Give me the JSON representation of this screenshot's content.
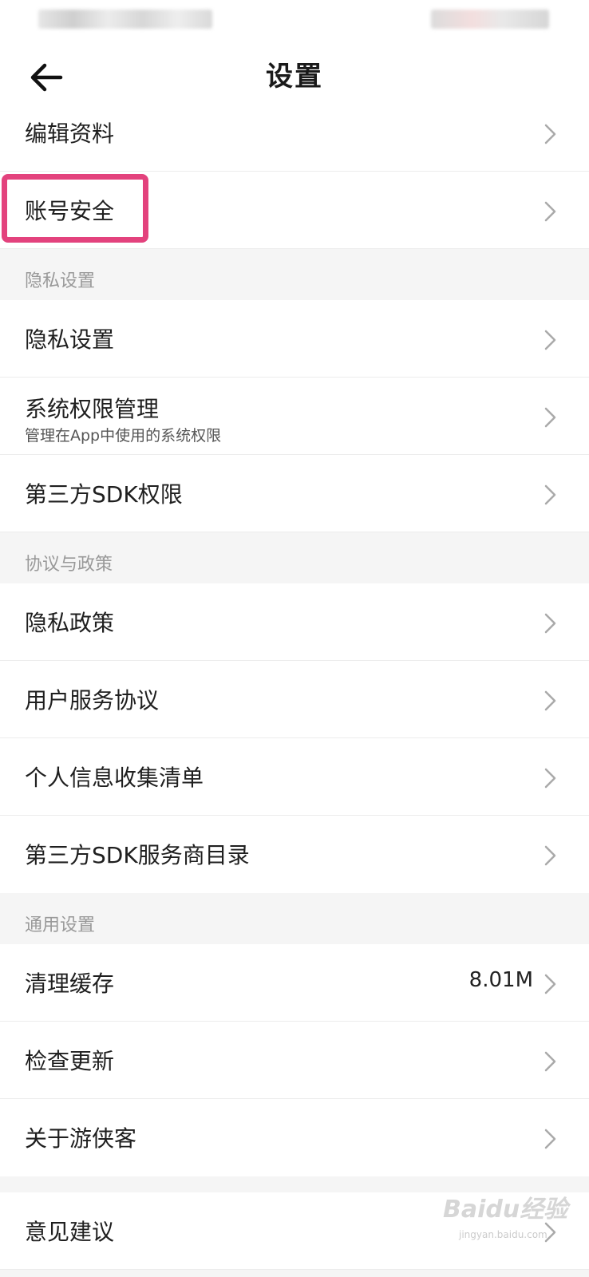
{
  "nav": {
    "title": "设置"
  },
  "rows_top": [
    {
      "label": "编辑资料"
    },
    {
      "label": "账号安全"
    }
  ],
  "sections": [
    {
      "header": "隐私设置",
      "rows": [
        {
          "label": "隐私设置",
          "sub": ""
        },
        {
          "label": "系统权限管理",
          "sub": "管理在App中使用的系统权限"
        },
        {
          "label": "第三方SDK权限",
          "sub": ""
        }
      ]
    },
    {
      "header": "协议与政策",
      "rows": [
        {
          "label": "隐私政策"
        },
        {
          "label": "用户服务协议"
        },
        {
          "label": "个人信息收集清单"
        },
        {
          "label": "第三方SDK服务商目录"
        }
      ]
    },
    {
      "header": "通用设置",
      "rows": [
        {
          "label": "清理缓存",
          "value": "8.01M"
        },
        {
          "label": "检查更新"
        },
        {
          "label": "关于游侠客"
        }
      ]
    }
  ],
  "rows_bottom": [
    {
      "label": "意见建议"
    }
  ],
  "watermark": {
    "brand": "Baidu经验",
    "url": "jingyan.baidu.com"
  },
  "colors": {
    "highlight": "#e3427d",
    "background": "#f5f5f5"
  }
}
